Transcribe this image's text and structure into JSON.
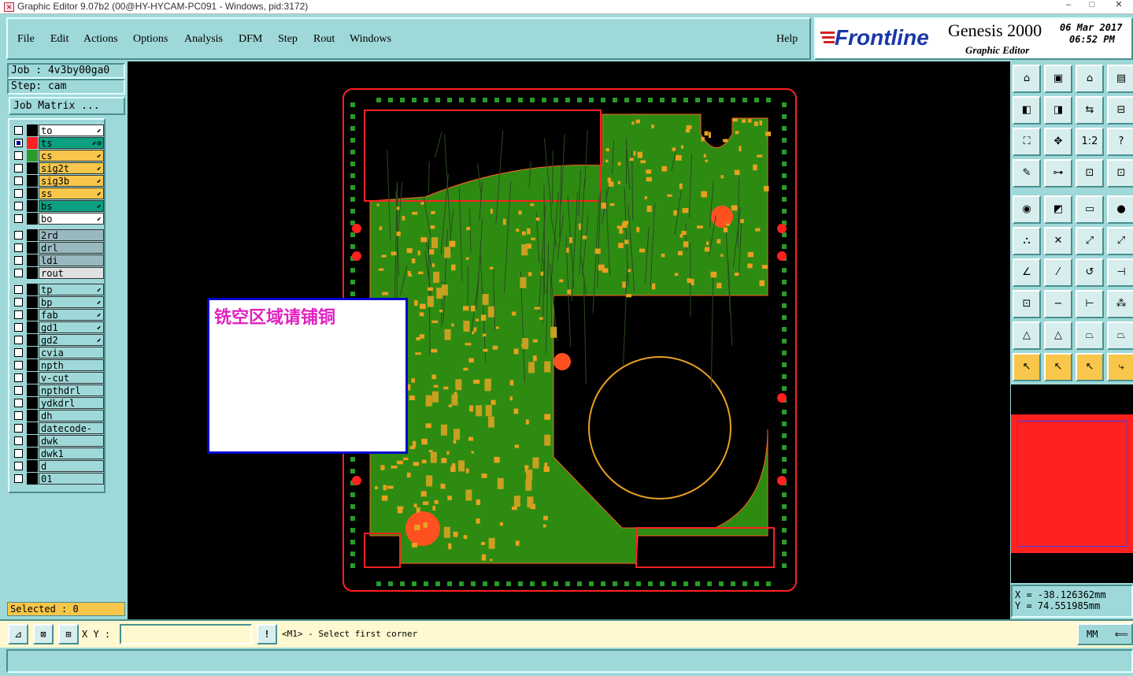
{
  "window": {
    "title": "Graphic Editor 9.07b2 (00@HY-HYCAM-PC091 - Windows, pid:3172)",
    "min": "–",
    "max": "□",
    "close": "✕"
  },
  "menu": {
    "items": [
      "File",
      "Edit",
      "Actions",
      "Options",
      "Analysis",
      "DFM",
      "Step",
      "Rout",
      "Windows"
    ],
    "help": "Help"
  },
  "logo": {
    "brand": "Frontline",
    "product": "Genesis 2000",
    "subtitle": "Graphic Editor",
    "date": "06 Mar 2017",
    "time": "06:52 PM"
  },
  "job": {
    "job_label": "Job : 4v3by00ga0",
    "step_label": "Step: cam",
    "matrix_button": "Job Matrix ..."
  },
  "layers_group1": [
    {
      "name": "to",
      "color": "#ffffff",
      "swatch": "#000000",
      "mark": "⬋"
    },
    {
      "name": "ts",
      "color": "#0aa080",
      "swatch": "#ff2020",
      "mark": "⬋⊕",
      "on": true
    },
    {
      "name": "cs",
      "color": "#f8c64a",
      "swatch": "#2a9a2a",
      "mark": "⬋"
    },
    {
      "name": "sig2t",
      "color": "#f8c64a",
      "swatch": "#000000",
      "mark": "⬋"
    },
    {
      "name": "sig3b",
      "color": "#f8c64a",
      "swatch": "#000000",
      "mark": "⬋"
    },
    {
      "name": "ss",
      "color": "#f8c64a",
      "swatch": "#000000",
      "mark": "⬋"
    },
    {
      "name": "bs",
      "color": "#0aa080",
      "swatch": "#000000",
      "mark": "⬋"
    },
    {
      "name": "bo",
      "color": "#ffffff",
      "swatch": "#000000",
      "mark": "⬋"
    }
  ],
  "layers_group2": [
    {
      "name": "2rd",
      "color": "#9ab8c0"
    },
    {
      "name": "drl",
      "color": "#9ab8c0"
    },
    {
      "name": "ldi",
      "color": "#9ab8c0"
    },
    {
      "name": "rout",
      "color": "#e0e0e0"
    }
  ],
  "layers_group3": [
    {
      "name": "tp",
      "mark": "⬋"
    },
    {
      "name": "bp",
      "mark": "⬋"
    },
    {
      "name": "fab",
      "mark": "⬋"
    },
    {
      "name": "gd1",
      "mark": "⬋"
    },
    {
      "name": "gd2",
      "mark": "⬋"
    },
    {
      "name": "cvia",
      "mark": ""
    },
    {
      "name": "npth",
      "mark": ""
    },
    {
      "name": "v-cut",
      "mark": ""
    },
    {
      "name": "npthdrl",
      "mark": ""
    },
    {
      "name": "ydkdrl",
      "mark": ""
    },
    {
      "name": "dh",
      "mark": ""
    },
    {
      "name": "datecode-to",
      "mark": ""
    },
    {
      "name": "dwk",
      "mark": ""
    },
    {
      "name": "dwk1",
      "mark": ""
    },
    {
      "name": "d",
      "mark": ""
    },
    {
      "name": "01",
      "mark": ""
    }
  ],
  "selected": "Selected : 0",
  "note": "铣空区域请铺铜",
  "coords": {
    "x": "X = -38.126362mm",
    "y": "Y = 74.551985mm"
  },
  "bottom": {
    "xy_label": "X Y :",
    "prompt": "<M1> - Select first corner",
    "units": "MM",
    "input_value": ""
  },
  "colors": {
    "board": "#2e8b12",
    "outline": "#ff2020",
    "pad": "#e8a020"
  }
}
